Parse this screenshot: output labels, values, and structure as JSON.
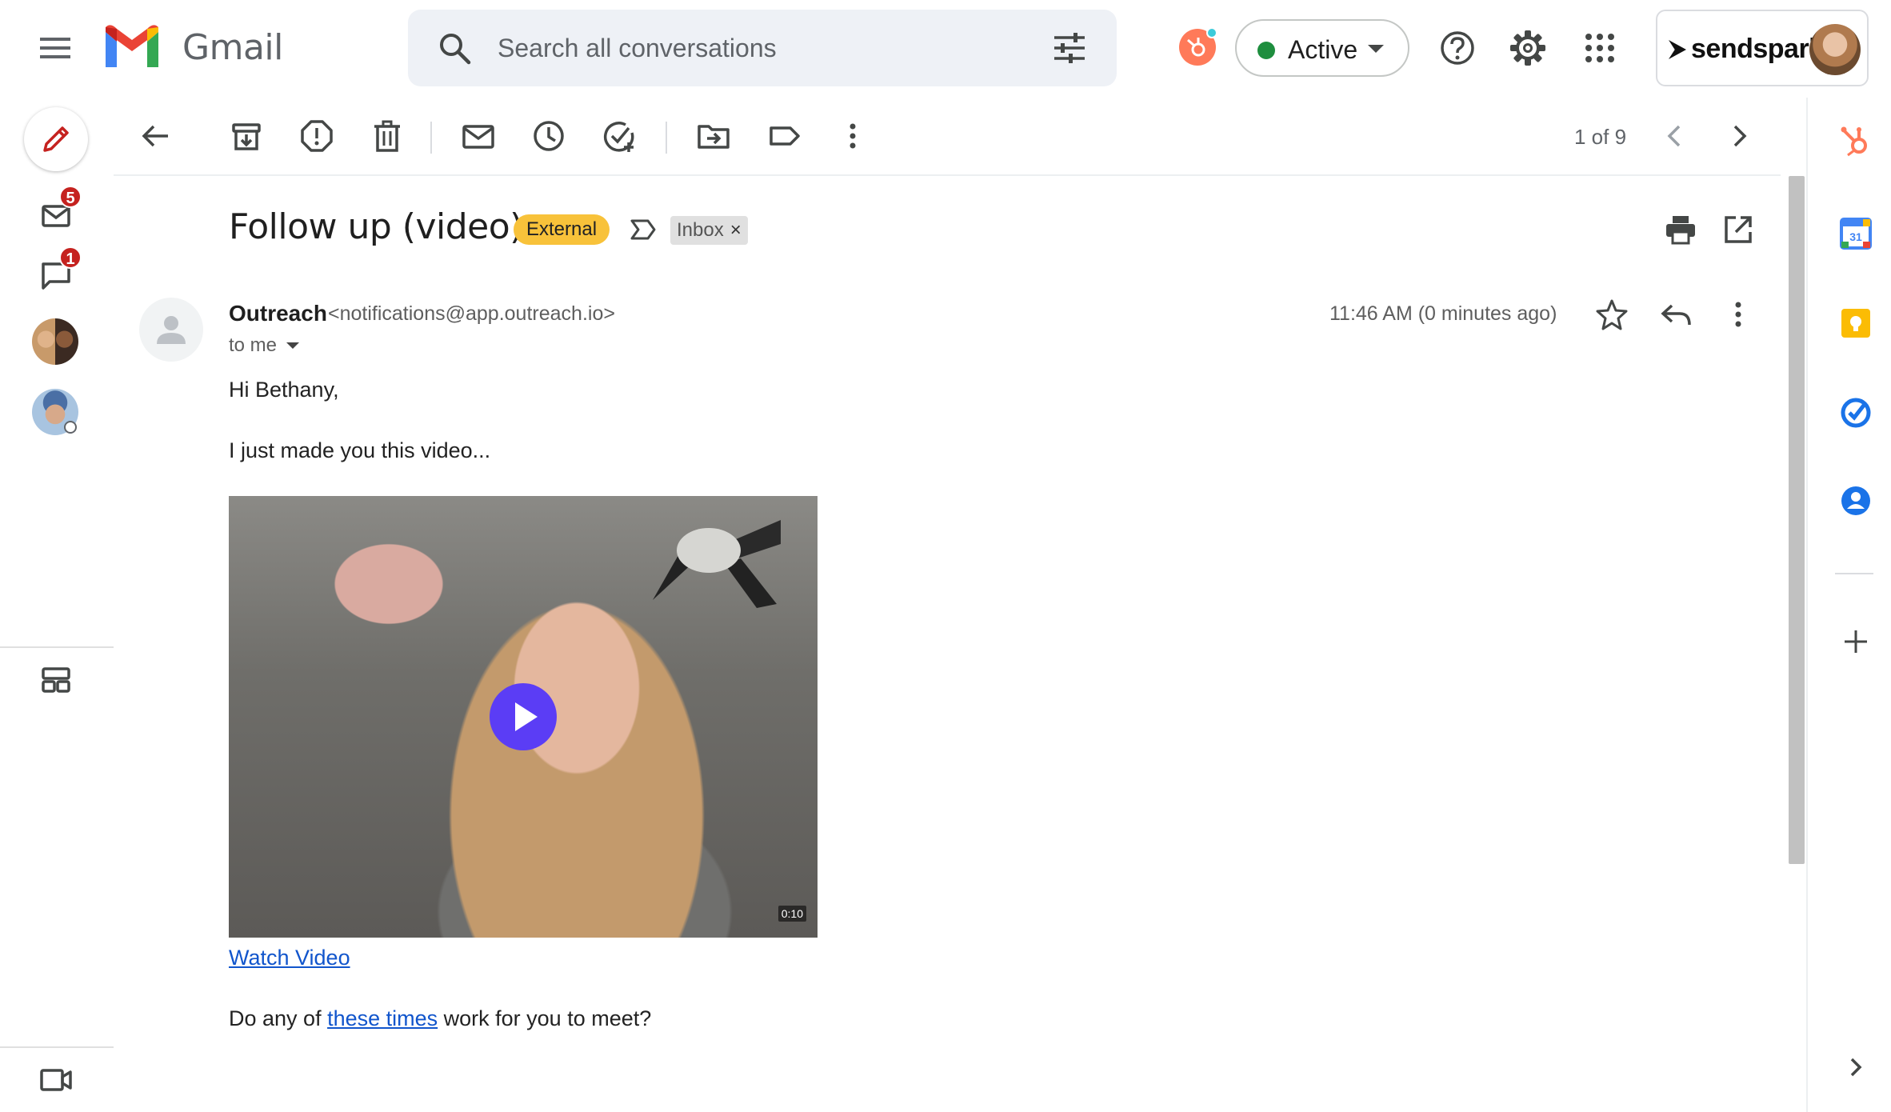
{
  "app": {
    "name": "Gmail"
  },
  "search": {
    "placeholder": "Search all conversations"
  },
  "status": {
    "label": "Active",
    "color": "#1e8e3e"
  },
  "account": {
    "brand": "sendspark"
  },
  "rail": {
    "mail_badge": "5",
    "chat_badge": "1"
  },
  "toolbar": {
    "pager": "1 of 9"
  },
  "email": {
    "subject": "Follow up (video)",
    "labels": {
      "external": "External",
      "inbox": "Inbox"
    },
    "sender_name": "Outreach",
    "sender_email": "<notifications@app.outreach.io>",
    "to": "to me",
    "timestamp": "11:46 AM (0 minutes ago)",
    "greeting": "Hi Bethany,",
    "line1": "I just made you this video...",
    "video_duration": "0:10",
    "watch_link": "Watch Video",
    "line2_before": "Do any of ",
    "line2_link": "these times",
    "line2_after": " work for you to meet?"
  },
  "colors": {
    "external_chip": "#f8c23a",
    "link": "#1155cc",
    "play_button": "#5b3df5",
    "badge": "#c5221f"
  },
  "icons": [
    "menu-icon",
    "gmail-logo",
    "search-icon",
    "tune-icon",
    "hubspot-icon",
    "help-icon",
    "gear-icon",
    "apps-grid-icon",
    "pencil-icon",
    "mail-icon",
    "chat-icon",
    "spaces-icon",
    "video-camera-icon",
    "back-arrow-icon",
    "archive-icon",
    "report-spam-icon",
    "trash-icon",
    "mark-unread-icon",
    "snooze-icon",
    "add-task-icon",
    "move-to-icon",
    "label-icon",
    "more-vert-icon",
    "chevron-left-icon",
    "chevron-right-icon",
    "print-icon",
    "open-new-window-icon",
    "star-icon",
    "reply-icon",
    "calendar-icon",
    "keep-icon",
    "tasks-icon",
    "contacts-icon",
    "plus-icon"
  ]
}
